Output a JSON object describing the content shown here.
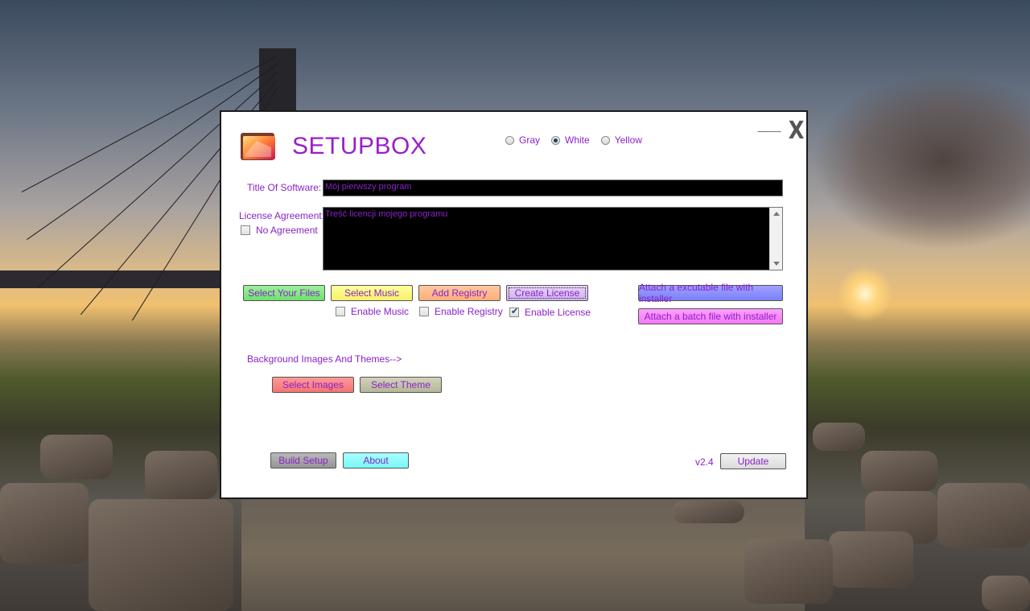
{
  "app": {
    "title": "SETUPBOX",
    "minimize_label": "~~~~~~",
    "close_label": "X",
    "version": "v2.4"
  },
  "theme": {
    "options": [
      {
        "label": "Gray",
        "selected": false
      },
      {
        "label": "White",
        "selected": true
      },
      {
        "label": "Yellow",
        "selected": false
      }
    ]
  },
  "form": {
    "title_label": "Title Of Software:",
    "title_value": "Mój pierwszy program",
    "license_label": "License Agreement:",
    "license_value": "Treść licencji mojego programu",
    "no_agreement_label": "No Agreement",
    "no_agreement_checked": false
  },
  "buttons": {
    "select_files": "Select Your Files",
    "select_music": "Select Music",
    "add_registry": "Add Registry",
    "create_license": "Create License",
    "attach_exe": "Attach a excutable file with installer",
    "attach_batch": "Attach a batch file with installer",
    "select_images": "Select Images",
    "select_theme": "Select Theme",
    "build_setup": "Build Setup",
    "about": "About",
    "update": "Update"
  },
  "checkboxes": {
    "enable_music": {
      "label": "Enable Music",
      "checked": false
    },
    "enable_registry": {
      "label": "Enable Registry",
      "checked": false
    },
    "enable_license": {
      "label": "Enable License",
      "checked": true
    }
  },
  "section": {
    "themes_label": "Background Images And Themes-->"
  },
  "colors": {
    "accent_text": "#8a22c8",
    "title": "#9a1fc9"
  }
}
